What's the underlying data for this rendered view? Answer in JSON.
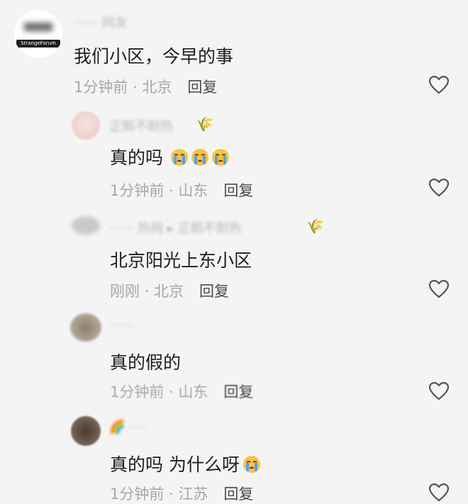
{
  "comments": [
    {
      "username": "······ 网友",
      "avatar_label": "StrangeForum",
      "text": "我们小区，今早的事",
      "time": "1分钟前 · 北京",
      "reply": "回复",
      "like_icon": "heart-outline-icon"
    },
    {
      "username": "正鹅不耐热",
      "name_emoji": "🌾",
      "text": "真的吗",
      "text_emoji": "loudly-crying-face",
      "time": "1分钟前 · 山东",
      "reply": "回复",
      "like_icon": "heart-outline-icon"
    },
    {
      "username": "······ 热网 ▸ 正鹅不耐热",
      "name_emoji": "🌾",
      "text": "北京阳光上东小区",
      "time": "刚刚 · 北京",
      "reply": "回复",
      "like_icon": "heart-outline-icon"
    },
    {
      "username": "······",
      "text": "真的假的",
      "time": "1分钟前 · 山东",
      "reply": "回复",
      "like_icon": "heart-outline-icon"
    },
    {
      "username": "🌈 ····",
      "text": "真的吗 为什么呀",
      "text_emoji": "loudly-crying-face",
      "time": "1分钟前 · 江苏",
      "reply": "回复",
      "like_icon": "heart-outline-icon"
    }
  ]
}
